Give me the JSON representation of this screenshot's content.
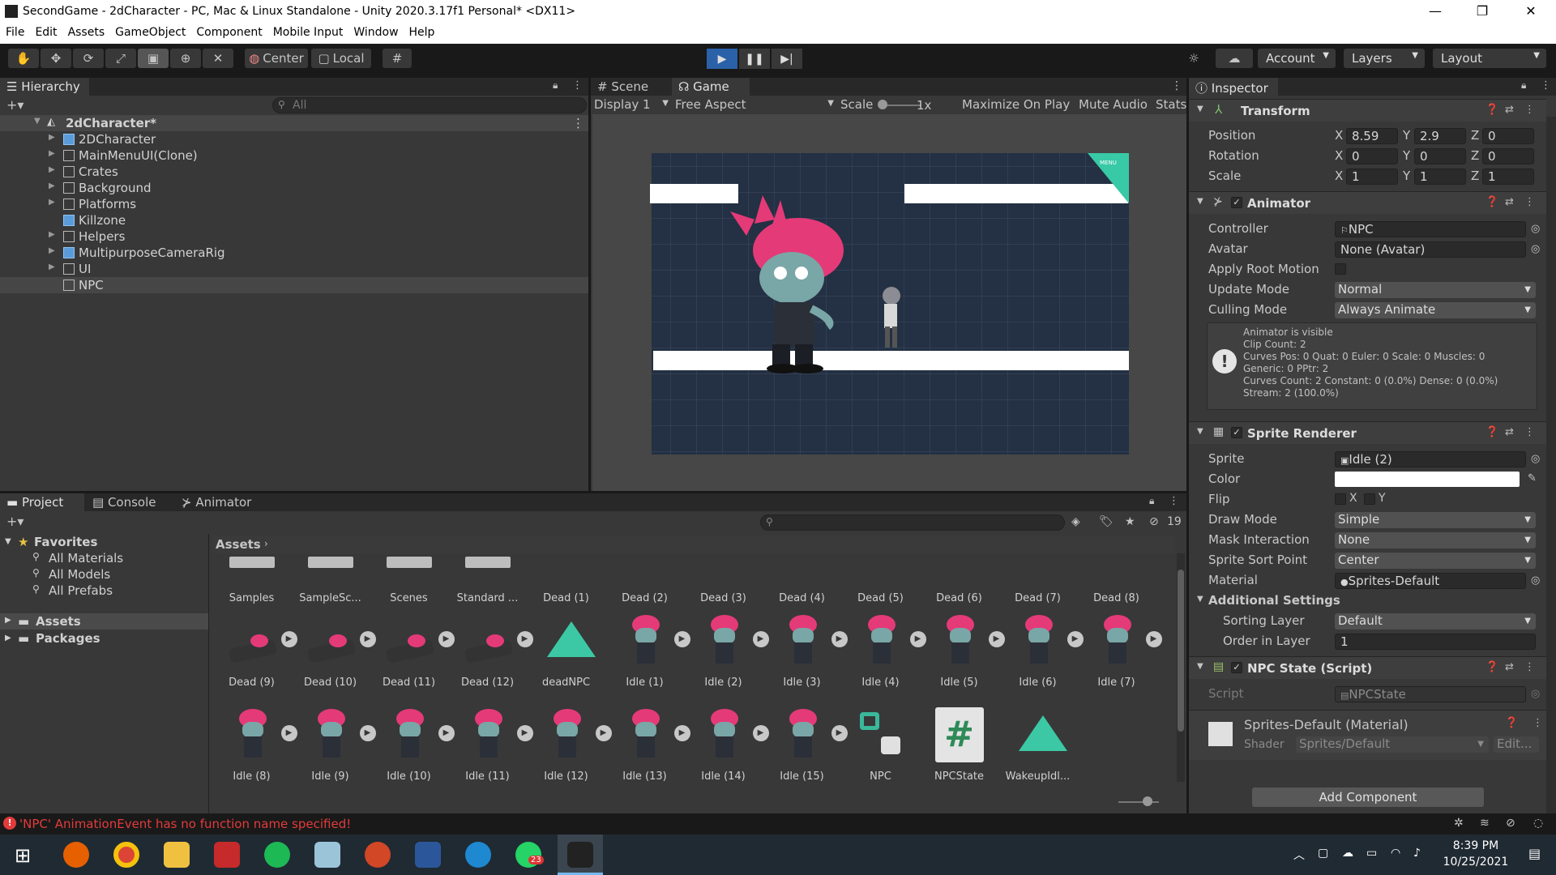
{
  "window": {
    "title": "SecondGame - 2dCharacter - PC, Mac & Linux Standalone - Unity 2020.3.17f1 Personal* <DX11>",
    "controls": [
      "—",
      "❐",
      "✕"
    ]
  },
  "menu": [
    "File",
    "Edit",
    "Assets",
    "GameObject",
    "Component",
    "Mobile Input",
    "Window",
    "Help"
  ],
  "toolbar": {
    "pivot": "Center",
    "space": "Local",
    "account": "Account",
    "layers": "Layers",
    "layout": "Layout"
  },
  "hierarchy": {
    "tab": "Hierarchy",
    "search_placeholder": "All",
    "scene": "2dCharacter*",
    "items": [
      {
        "label": "2DCharacter",
        "blue": true,
        "arrow": true
      },
      {
        "label": "MainMenuUI(Clone)",
        "blue": false,
        "arrow": true
      },
      {
        "label": "Crates",
        "blue": false,
        "arrow": true
      },
      {
        "label": "Background",
        "blue": false,
        "arrow": true
      },
      {
        "label": "Platforms",
        "blue": false,
        "arrow": true
      },
      {
        "label": "Killzone",
        "blue": true,
        "arrow": false
      },
      {
        "label": "Helpers",
        "blue": false,
        "arrow": true
      },
      {
        "label": "MultipurposeCameraRig",
        "blue": true,
        "arrow": true
      },
      {
        "label": "UI",
        "blue": false,
        "arrow": true
      },
      {
        "label": "NPC",
        "blue": false,
        "arrow": false
      }
    ]
  },
  "game": {
    "tabs": [
      "Scene",
      "Game"
    ],
    "display": "Display 1",
    "aspect": "Free Aspect",
    "scale_label": "Scale",
    "scale_value": "1x",
    "maximize": "Maximize On Play",
    "mute": "Mute Audio",
    "stats": "Stats",
    "menu_badge": "MENU"
  },
  "inspector": {
    "tab": "Inspector",
    "transform": {
      "title": "Transform",
      "position_label": "Position",
      "position": [
        "8.59",
        "2.9",
        "0"
      ],
      "rotation_label": "Rotation",
      "rotation": [
        "0",
        "0",
        "0"
      ],
      "scale_label": "Scale",
      "scale": [
        "1",
        "1",
        "1"
      ]
    },
    "animator": {
      "title": "Animator",
      "controller_label": "Controller",
      "controller": "NPC",
      "avatar_label": "Avatar",
      "avatar": "None (Avatar)",
      "root_motion_label": "Apply Root Motion",
      "update_mode_label": "Update Mode",
      "update_mode": "Normal",
      "culling_label": "Culling Mode",
      "culling": "Always Animate",
      "info": [
        "Animator is visible",
        "Clip Count: 2",
        "Curves Pos: 0 Quat: 0 Euler: 0 Scale: 0 Muscles: 0",
        "Generic: 0 PPtr: 2",
        "Curves Count: 2 Constant: 0 (0.0%) Dense: 0 (0.0%)",
        "Stream: 2 (100.0%)"
      ]
    },
    "sprite_renderer": {
      "title": "Sprite Renderer",
      "sprite_label": "Sprite",
      "sprite": "Idle (2)",
      "color_label": "Color",
      "flip_label": "Flip",
      "flip_x": "X",
      "flip_y": "Y",
      "draw_mode_label": "Draw Mode",
      "draw_mode": "Simple",
      "mask_label": "Mask Interaction",
      "mask": "None",
      "sort_point_label": "Sprite Sort Point",
      "sort_point": "Center",
      "material_label": "Material",
      "material": "Sprites-Default",
      "additional_label": "Additional Settings",
      "sorting_layer_label": "Sorting Layer",
      "sorting_layer": "Default",
      "order_label": "Order in Layer",
      "order": "1"
    },
    "npc_state": {
      "title": "NPC State (Script)",
      "script_label": "Script",
      "script": "NPCState"
    },
    "material": {
      "title": "Sprites-Default (Material)",
      "shader_label": "Shader",
      "shader": "Sprites/Default",
      "edit": "Edit..."
    },
    "add_component": "Add Component"
  },
  "project": {
    "tabs": [
      "Project",
      "Console",
      "Animator"
    ],
    "hidden_count": "19",
    "favorites": "Favorites",
    "fav_items": [
      "All Materials",
      "All Models",
      "All Prefabs"
    ],
    "roots": [
      "Assets",
      "Packages"
    ],
    "breadcrumb": "Assets",
    "row1": [
      "Samples",
      "SampleSc...",
      "Scenes",
      "Standard ...",
      "Dead (1)",
      "Dead (2)",
      "Dead (3)",
      "Dead (4)",
      "Dead (5)",
      "Dead (6)",
      "Dead (7)",
      "Dead (8)"
    ],
    "row2": [
      "Dead (9)",
      "Dead (10)",
      "Dead (11)",
      "Dead (12)",
      "deadNPC",
      "Idle (1)",
      "Idle (2)",
      "Idle (3)",
      "Idle (4)",
      "Idle (5)",
      "Idle (6)",
      "Idle (7)"
    ],
    "row3": [
      "Idle (8)",
      "Idle (9)",
      "Idle (10)",
      "Idle (11)",
      "Idle (12)",
      "Idle (13)",
      "Idle (14)",
      "Idle (15)",
      "NPC",
      "NPCState",
      "WakeupIdl..."
    ]
  },
  "status": {
    "message": "'NPC' AnimationEvent has no function name specified!"
  },
  "taskbar": {
    "time": "8:39 PM",
    "date": "10/25/2021",
    "whatsapp_badge": "23"
  },
  "colors": {
    "accent": "#2b61a8",
    "panel": "#383838",
    "error": "#e33b3b"
  }
}
